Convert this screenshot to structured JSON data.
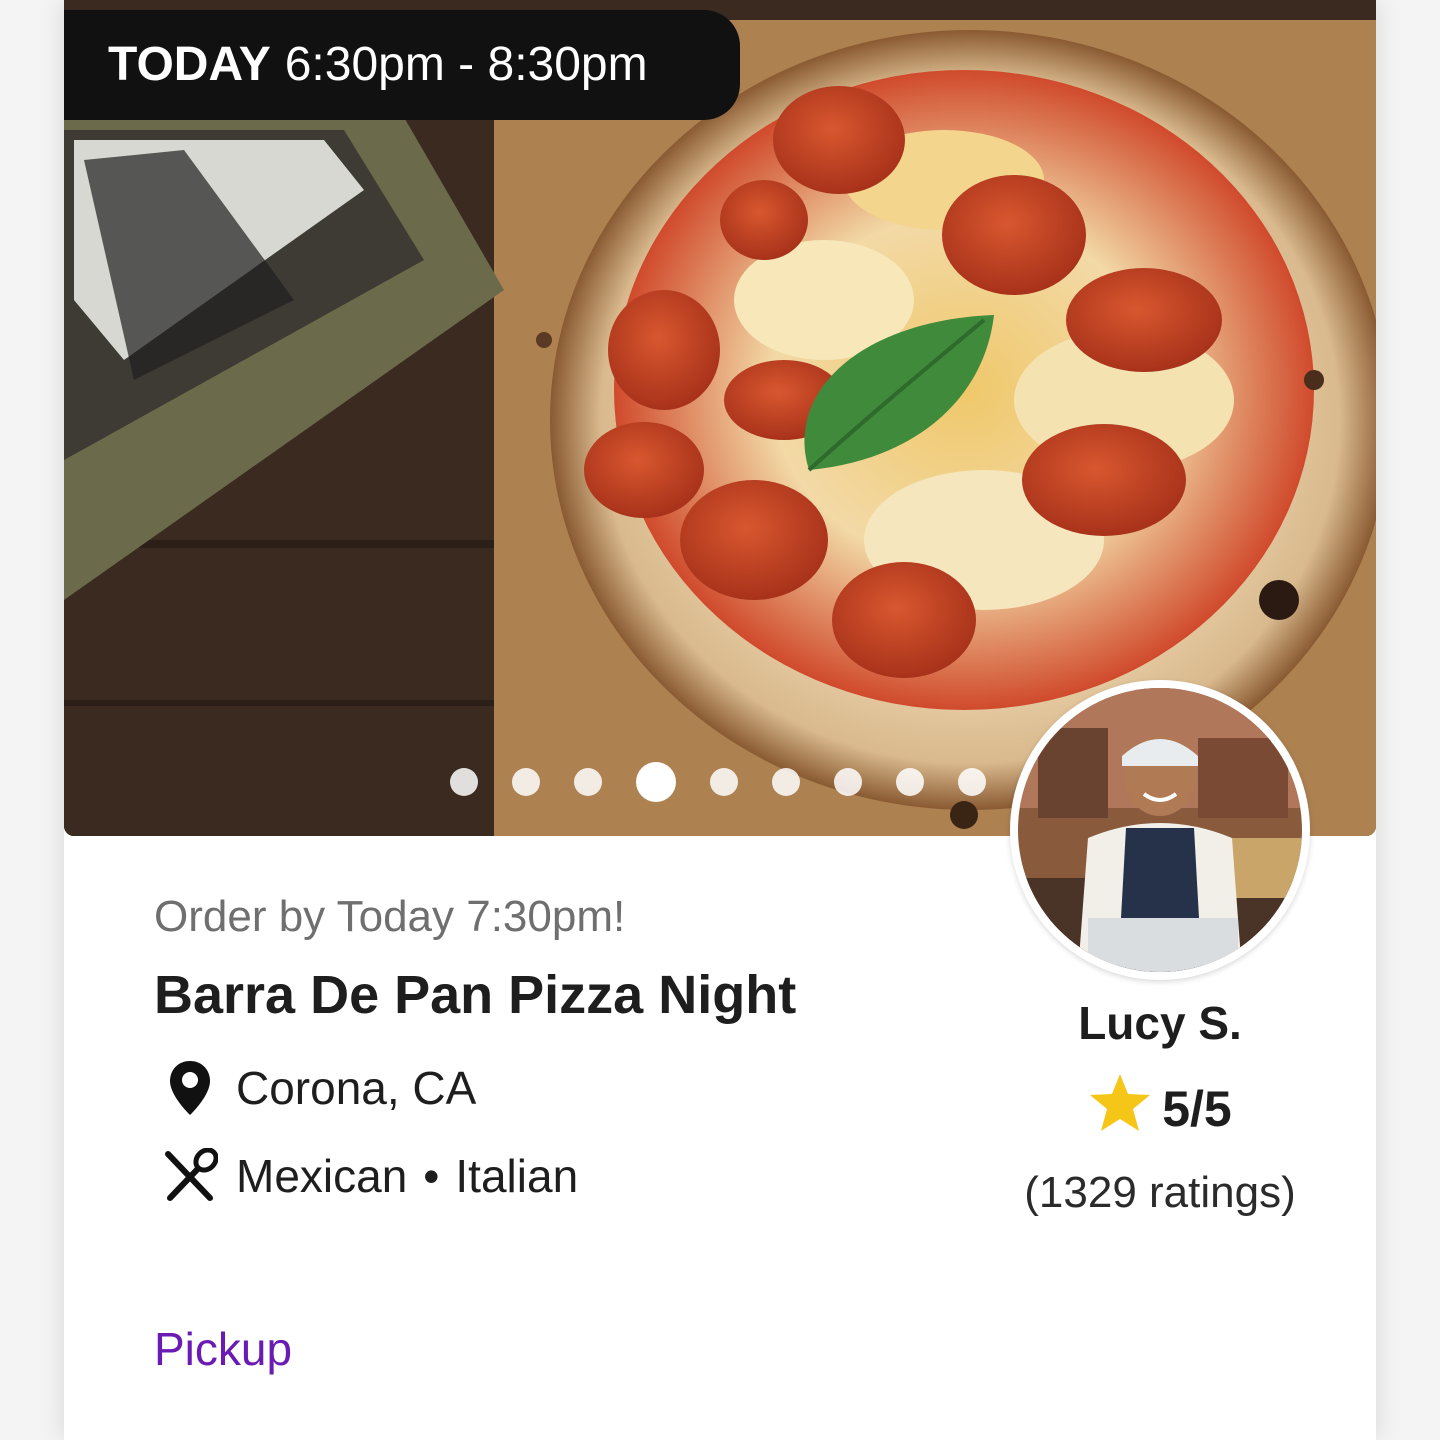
{
  "event": {
    "time_day": "TODAY",
    "time_range": "6:30pm - 8:30pm",
    "order_by": "Order by Today 7:30pm!",
    "title": "Barra De Pan Pizza Night",
    "location": "Corona, CA",
    "cuisines": [
      "Mexican",
      "Italian"
    ],
    "cuisine_separator": "•",
    "fulfillment": "Pickup"
  },
  "carousel": {
    "total_slides": 9,
    "active_index": 3
  },
  "chef": {
    "name": "Lucy S.",
    "rating": "5/5",
    "rating_count": "(1329 ratings)"
  },
  "icons": {
    "location": "map-pin-icon",
    "cuisine": "fork-spoon-icon",
    "rating": "star-icon"
  },
  "colors": {
    "accent": "#6a1bb3",
    "star": "#f5c518",
    "badge_bg": "#111111"
  }
}
